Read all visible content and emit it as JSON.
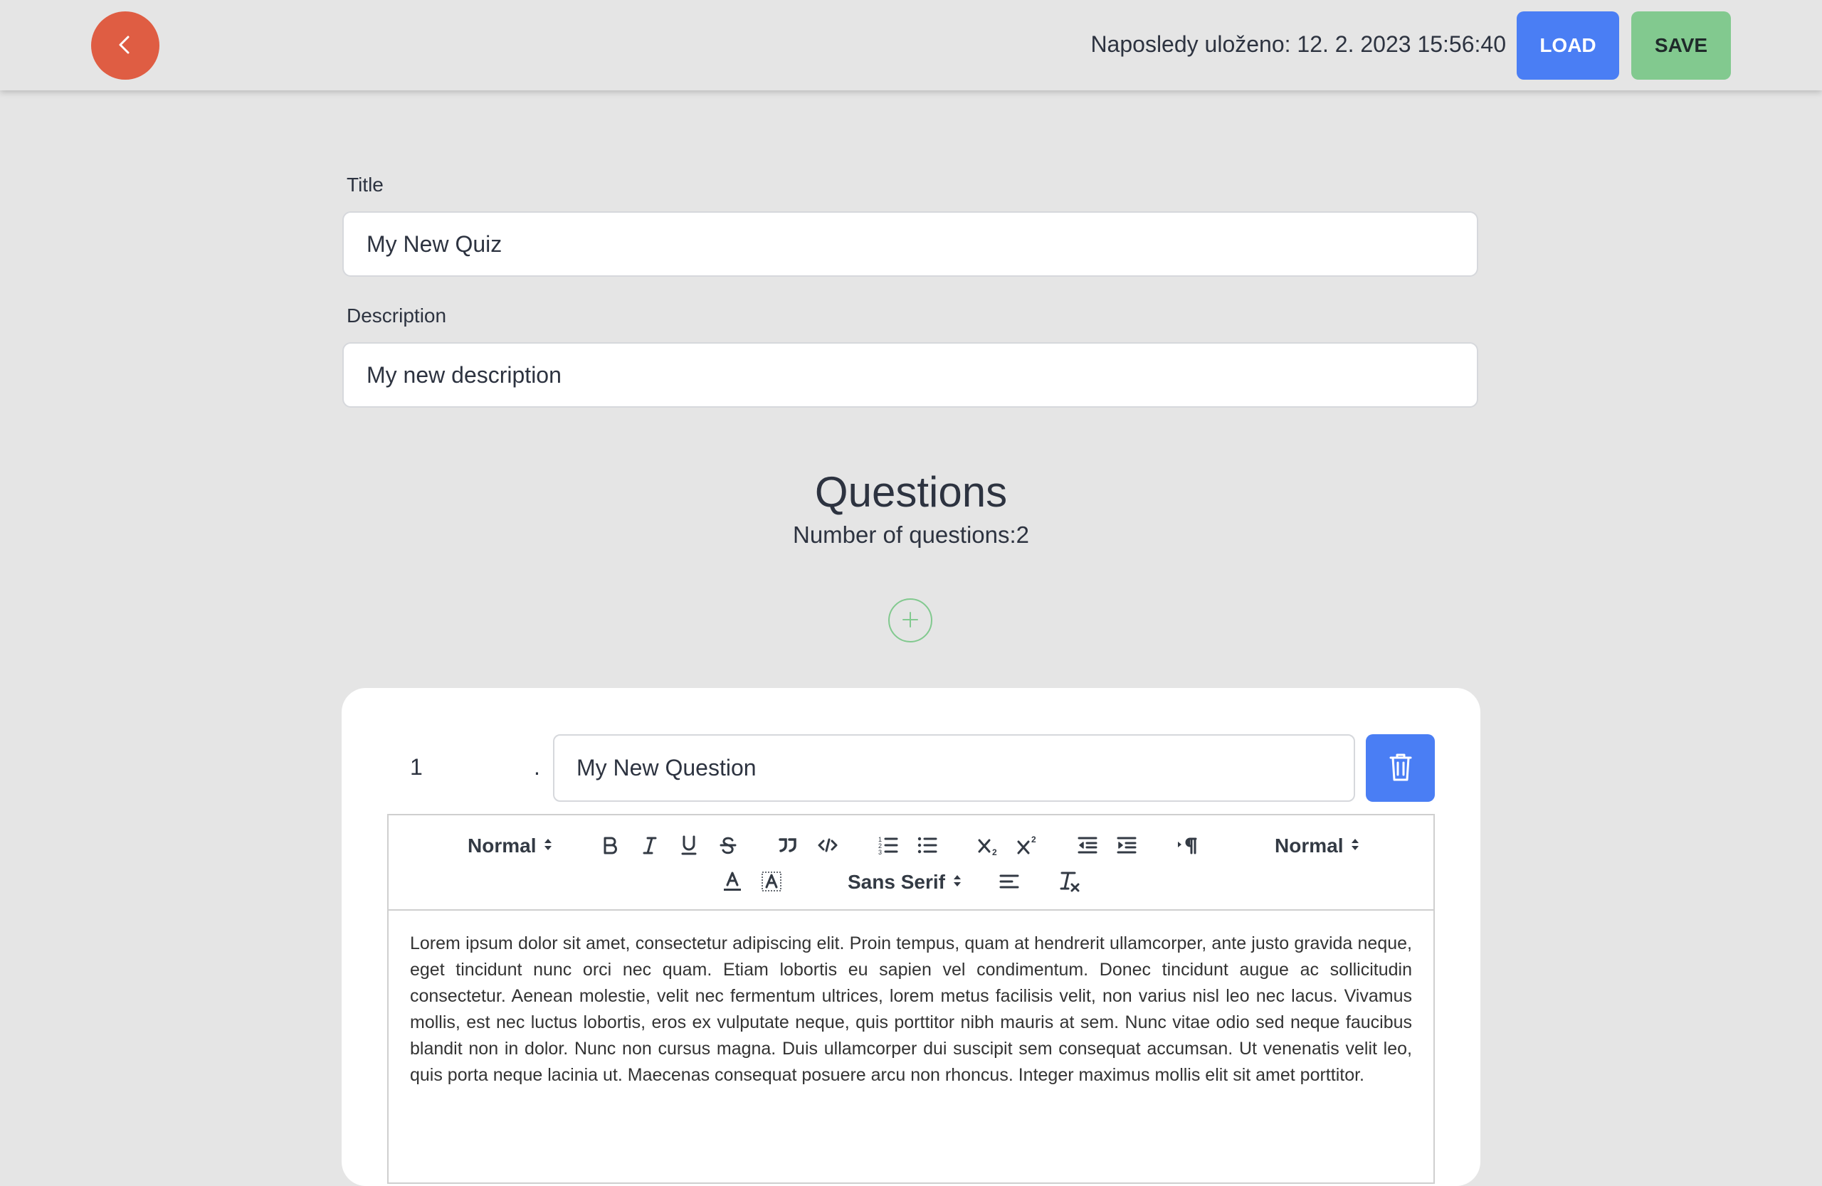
{
  "header": {
    "back_icon": "chevron-left-icon",
    "last_saved": "Naposledy uloženo: 12. 2. 2023 15:56:40",
    "load_label": "LOAD",
    "save_label": "SAVE",
    "colors": {
      "back": "#df5d43",
      "load": "#4a7ef4",
      "save": "#82c98f"
    }
  },
  "form": {
    "title_label": "Title",
    "title_value": "My New Quiz",
    "description_label": "Description",
    "description_value": "My new description"
  },
  "questions": {
    "heading": "Questions",
    "count_text": "Number of questions:2",
    "add_icon": "plus-icon",
    "items": [
      {
        "number": "1",
        "separator": ".",
        "title": "My New Question",
        "delete_icon": "trash-icon",
        "editor": {
          "header_picker": "Normal",
          "size_picker": "Normal",
          "font_picker": "Sans Serif",
          "body": "Lorem ipsum dolor sit amet, consectetur adipiscing elit. Proin tempus, quam at hendrerit ullamcorper, ante justo gravida neque, eget tincidunt nunc orci nec quam. Etiam lobortis eu sapien vel condimentum. Donec tincidunt augue ac sollicitudin consectetur. Aenean molestie, velit nec fermentum ultrices, lorem metus facilisis velit, non varius nisl leo nec lacus. Vivamus mollis, est nec luctus lobortis, eros ex vulputate neque, quis porttitor nibh mauris at sem. Nunc vitae odio sed neque faucibus blandit non in dolor. Nunc non cursus magna. Duis ullamcorper dui suscipit sem consequat accumsan. Ut venenatis velit leo, quis porta neque lacinia ut. Maecenas consequat posuere arcu non rhoncus. Integer maximus mollis elit sit amet porttitor."
        }
      }
    ]
  }
}
